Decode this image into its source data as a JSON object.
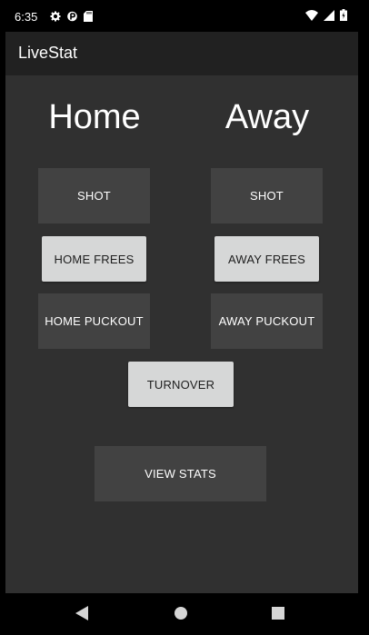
{
  "status_bar": {
    "time": "6:35",
    "icons_left": [
      "gear-icon",
      "p-icon",
      "sd-card-icon"
    ],
    "icons_right": [
      "wifi-icon",
      "signal-icon",
      "battery-charging-icon"
    ]
  },
  "app": {
    "title": "LiveStat"
  },
  "teams": {
    "home": "Home",
    "away": "Away"
  },
  "buttons": {
    "home_shot": "SHOT",
    "away_shot": "SHOT",
    "home_frees": "HOME FREES",
    "away_frees": "AWAY FREES",
    "home_puckout": "HOME PUCKOUT",
    "away_puckout": "AWAY PUCKOUT",
    "turnover": "TURNOVER",
    "view_stats": "VIEW STATS"
  },
  "nav_bar": {
    "icons": [
      "back-icon",
      "home-icon",
      "recents-icon"
    ]
  },
  "colors": {
    "background": "#303030",
    "app_bar": "#212121",
    "button_dark": "#424242",
    "button_light": "#d6d7d7"
  }
}
